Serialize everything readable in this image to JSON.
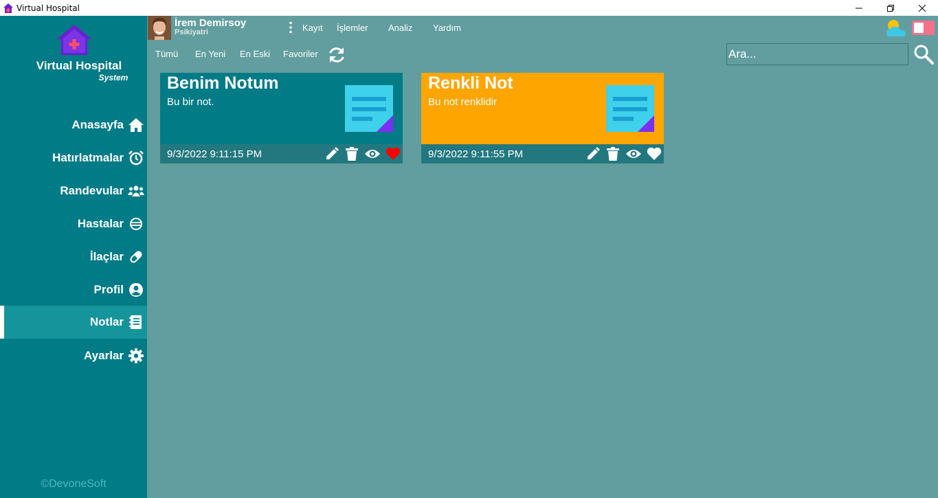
{
  "window": {
    "title": "Virtual Hospital",
    "controls": [
      "minimize-icon",
      "restore-icon",
      "close-icon"
    ]
  },
  "sidebar": {
    "brand_title": "Virtual Hospital",
    "brand_subtitle": "System",
    "items": [
      {
        "label": "Anasayfa",
        "icon": "home-icon"
      },
      {
        "label": "Hatırlatmalar",
        "icon": "alarm-clock-icon"
      },
      {
        "label": "Randevular",
        "icon": "people-group-icon"
      },
      {
        "label": "Hastalar",
        "icon": "patient-icon"
      },
      {
        "label": "İlaçlar",
        "icon": "pill-icon"
      },
      {
        "label": "Profil",
        "icon": "user-circle-icon"
      },
      {
        "label": "Notlar",
        "icon": "notebook-icon",
        "active": true
      },
      {
        "label": "Ayarlar",
        "icon": "gear-icon"
      }
    ],
    "copyright": "©DevoneSoft"
  },
  "user": {
    "name": "İrem Demirsoy",
    "role": "Psikiyatri"
  },
  "menu": [
    "Kayıt",
    "İşlemler",
    "Analiz",
    "Yardım"
  ],
  "filters": [
    "Tümü",
    "En Yeni",
    "En Eski",
    "Favoriler"
  ],
  "search": {
    "placeholder": "Ara..."
  },
  "notes": [
    {
      "title": "Benim Notum",
      "text": "Bu bir not.",
      "date": "9/3/2022 9:11:15 PM",
      "color": "#017b86",
      "favorite": true
    },
    {
      "title": "Renkli Not",
      "text": "Bu not renklidir",
      "date": "9/3/2022 9:11:55 PM",
      "color": "#ffa500",
      "favorite": false
    }
  ],
  "colors": {
    "sidebar": "#017b86",
    "sidebar_active": "#16949b",
    "content_bg": "#629e9f",
    "card_footer": "#23787f",
    "favorite_active": "#ff0000",
    "toggle": "#f4708a"
  }
}
